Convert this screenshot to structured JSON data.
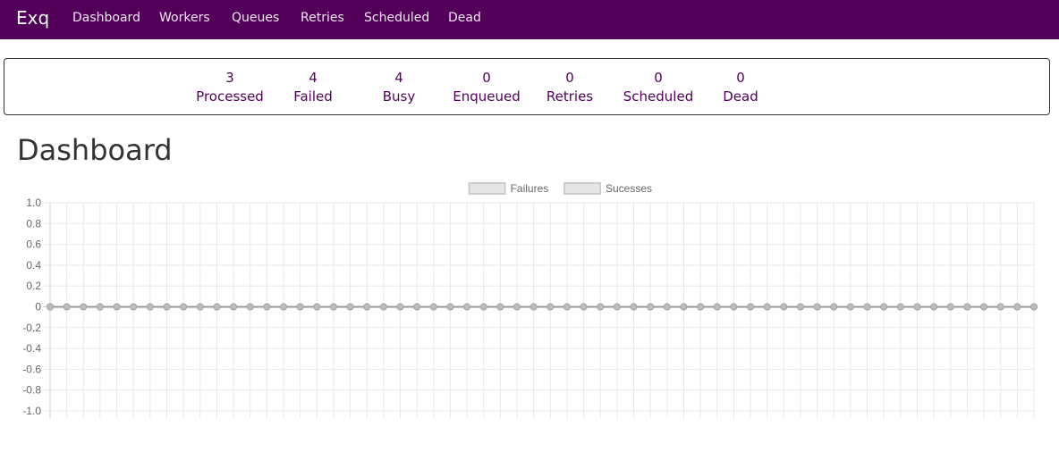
{
  "navbar": {
    "brand": "Exq",
    "items": [
      {
        "label": "Dashboard"
      },
      {
        "label": "Workers"
      },
      {
        "label": "Queues"
      },
      {
        "label": "Retries"
      },
      {
        "label": "Scheduled"
      },
      {
        "label": "Dead"
      }
    ],
    "background": "#52005a"
  },
  "stats": [
    {
      "value": "3",
      "label": "Processed"
    },
    {
      "value": "4",
      "label": "Failed"
    },
    {
      "value": "4",
      "label": "Busy"
    },
    {
      "value": "0",
      "label": "Enqueued"
    },
    {
      "value": "0",
      "label": "Retries"
    },
    {
      "value": "0",
      "label": "Scheduled"
    },
    {
      "value": "0",
      "label": "Dead"
    }
  ],
  "page": {
    "title": "Dashboard"
  },
  "chart_data": {
    "type": "line",
    "legend_placement": "top",
    "grid": true,
    "ylim": [
      -1.0,
      1.0
    ],
    "y_ticks": [
      "1.0",
      "0.8",
      "0.6",
      "0.4",
      "0.2",
      "0",
      "-0.2",
      "-0.4",
      "-0.6",
      "-0.8",
      "-1.0"
    ],
    "series": [
      {
        "name": "Failures",
        "color": "#dddddd",
        "values": [
          0,
          0,
          0,
          0,
          0,
          0,
          0,
          0,
          0,
          0,
          0,
          0,
          0,
          0,
          0,
          0,
          0,
          0,
          0,
          0,
          0,
          0,
          0,
          0,
          0,
          0,
          0,
          0,
          0,
          0,
          0,
          0,
          0,
          0,
          0,
          0,
          0,
          0,
          0,
          0,
          0,
          0,
          0,
          0,
          0,
          0,
          0,
          0,
          0,
          0,
          0,
          0,
          0,
          0,
          0,
          0,
          0,
          0,
          0,
          0
        ]
      },
      {
        "name": "Sucesses",
        "color": "#dddddd",
        "values": [
          0,
          0,
          0,
          0,
          0,
          0,
          0,
          0,
          0,
          0,
          0,
          0,
          0,
          0,
          0,
          0,
          0,
          0,
          0,
          0,
          0,
          0,
          0,
          0,
          0,
          0,
          0,
          0,
          0,
          0,
          0,
          0,
          0,
          0,
          0,
          0,
          0,
          0,
          0,
          0,
          0,
          0,
          0,
          0,
          0,
          0,
          0,
          0,
          0,
          0,
          0,
          0,
          0,
          0,
          0,
          0,
          0,
          0,
          0,
          0
        ]
      }
    ]
  }
}
